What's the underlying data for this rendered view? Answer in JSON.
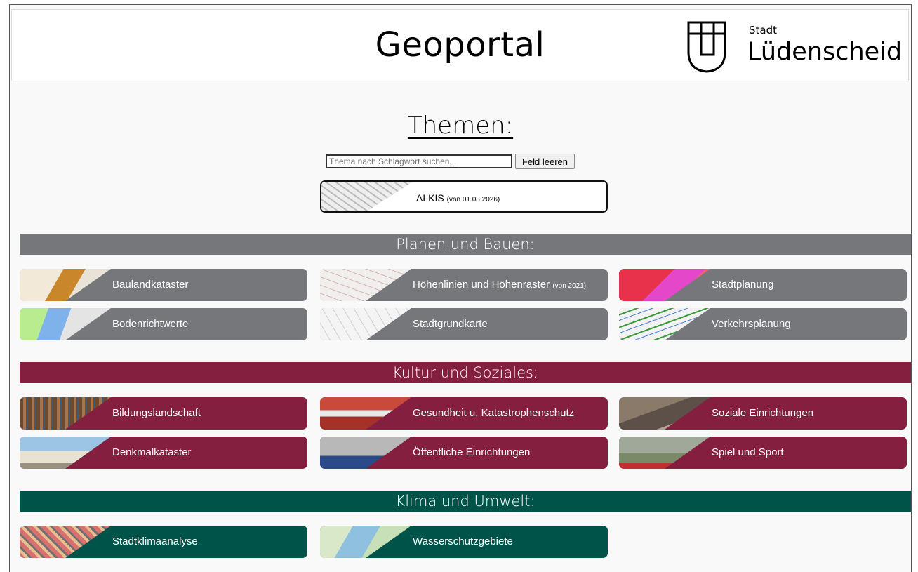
{
  "header": {
    "title": "Geoportal",
    "logo_small": "Stadt",
    "logo_big": "Lüdenscheid"
  },
  "themen": {
    "title": "Themen:",
    "search_placeholder": "Thema nach Schlagwort suchen...",
    "clear_label": "Feld leeren",
    "alkis_label": "ALKIS",
    "alkis_note": "(von 01.03.2026)"
  },
  "sections": [
    {
      "title": "Planen und Bauen:",
      "color": "#76777a",
      "tiles": [
        {
          "label": "Baulandkataster",
          "note": ""
        },
        {
          "label": "Höhenlinien und Höhenraster",
          "note": "(von 2021)"
        },
        {
          "label": "Stadtplanung",
          "note": ""
        },
        {
          "label": "Bodenrichtwerte",
          "note": ""
        },
        {
          "label": "Stadtgrundkarte",
          "note": ""
        },
        {
          "label": "Verkehrsplanung",
          "note": ""
        }
      ]
    },
    {
      "title": "Kultur und Soziales:",
      "color": "#841f3f",
      "tiles": [
        {
          "label": "Bildungslandschaft",
          "note": ""
        },
        {
          "label": "Gesundheit u. Katastrophenschutz",
          "note": ""
        },
        {
          "label": "Soziale Einrichtungen",
          "note": ""
        },
        {
          "label": "Denkmalkataster",
          "note": ""
        },
        {
          "label": "Öffentliche Einrichtungen",
          "note": ""
        },
        {
          "label": "Spiel und Sport",
          "note": ""
        }
      ]
    },
    {
      "title": "Klima und Umwelt:",
      "color": "#005349",
      "tiles": [
        {
          "label": "Stadtklimaanalyse",
          "note": ""
        },
        {
          "label": "Wasserschutzgebiete",
          "note": ""
        }
      ]
    }
  ]
}
